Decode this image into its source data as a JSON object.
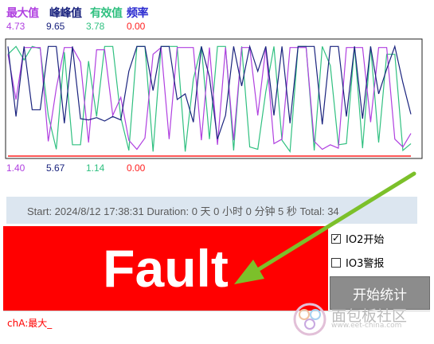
{
  "legend": [
    {
      "label": "最大值",
      "color": "#b040e0"
    },
    {
      "label": "峰峰值",
      "color": "#1a237e"
    },
    {
      "label": "有效值",
      "color": "#30c080"
    },
    {
      "label": "频率",
      "color": "#2a2ad0"
    }
  ],
  "top_values": [
    "4.73",
    "9.65",
    "3.78",
    "0.00"
  ],
  "bottom_values": [
    "1.40",
    "5.67",
    "1.14",
    "0.00"
  ],
  "value_colors": [
    "#b040e0",
    "#1a237e",
    "#30c080",
    "#ff2020"
  ],
  "chart_data": {
    "type": "line",
    "grid": false,
    "x": [
      0,
      1,
      2,
      3,
      4,
      5,
      6,
      7,
      8,
      9,
      10,
      11,
      12,
      13,
      14,
      15,
      16,
      17,
      18,
      19,
      20,
      21,
      22,
      23,
      24,
      25,
      26,
      27,
      28,
      29,
      30,
      31,
      32,
      33,
      34,
      35,
      36,
      37,
      38,
      39,
      40,
      41,
      42,
      43,
      44,
      45,
      46,
      47,
      48,
      49,
      50
    ],
    "ylim": [
      0,
      10
    ],
    "series": [
      {
        "name": "最大值",
        "color": "#b040e0",
        "values": [
          9.0,
          5.0,
          9.6,
          9.6,
          9.6,
          1.3,
          6.0,
          9.6,
          9.6,
          8.3,
          1.2,
          9.4,
          9.4,
          3.6,
          5.2,
          1.4,
          0.6,
          1.6,
          9.0,
          9.6,
          1.5,
          9.6,
          9.6,
          9.6,
          1.4,
          9.6,
          1.0,
          9.6,
          1.4,
          9.6,
          9.6,
          3.6,
          9.6,
          1.1,
          1.5,
          9.6,
          9.6,
          9.6,
          1.3,
          0.6,
          1.0,
          0.7,
          9.6,
          9.6,
          9.6,
          3.0,
          9.6,
          9.6,
          1.5,
          0.8,
          2.0
        ]
      },
      {
        "name": "峰峰值",
        "color": "#1a237e",
        "values": [
          9.7,
          3.5,
          9.7,
          4.1,
          4.1,
          9.7,
          9.7,
          2.9,
          9.7,
          3.3,
          3.2,
          3.4,
          3.1,
          3.5,
          3.2,
          7.5,
          9.7,
          9.7,
          5.8,
          9.7,
          9.7,
          5.0,
          5.5,
          3.0,
          9.7,
          7.0,
          1.5,
          3.6,
          9.7,
          6.2,
          9.7,
          7.5,
          9.7,
          3.6,
          9.7,
          2.9,
          9.7,
          9.7,
          9.7,
          2.8,
          9.7,
          9.7,
          3.5,
          9.7,
          3.3,
          9.7,
          5.5,
          7.7,
          9.7,
          6.5,
          3.7
        ]
      },
      {
        "name": "有效值",
        "color": "#30c080",
        "values": [
          9.0,
          9.7,
          8.5,
          9.7,
          9.5,
          3.6,
          0.6,
          9.2,
          1.0,
          1.0,
          8.4,
          3.5,
          9.7,
          9.7,
          3.4,
          0.5,
          9.7,
          9.7,
          0.4,
          9.7,
          9.7,
          9.7,
          0.4,
          6.8,
          9.7,
          1.5,
          9.7,
          9.7,
          0.5,
          9.7,
          0.8,
          0.6,
          5.7,
          9.7,
          1.4,
          0.4,
          9.7,
          9.7,
          0.5,
          9.7,
          8.0,
          1.0,
          1.1,
          9.7,
          0.7,
          9.7,
          1.2,
          9.0,
          9.0,
          0.5,
          1.1
        ]
      },
      {
        "name": "频率",
        "color": "#ff2020",
        "values": [
          0,
          0,
          0,
          0,
          0,
          0,
          0,
          0,
          0,
          0,
          0,
          0,
          0,
          0,
          0,
          0,
          0,
          0,
          0,
          0,
          0,
          0,
          0,
          0,
          0,
          0,
          0,
          0,
          0,
          0,
          0,
          0,
          0,
          0,
          0,
          0,
          0,
          0,
          0,
          0,
          0,
          0,
          0,
          0,
          0,
          0,
          0,
          0,
          0,
          0,
          0
        ]
      }
    ]
  },
  "status": {
    "text": "Start: 2024/8/12 17:38:31  Duration: 0 天 0 小时 0 分钟 5 秒  Total: 34"
  },
  "fault": {
    "label": "Fault",
    "bg_color": "#ff0000"
  },
  "checkboxes": [
    {
      "label": "IO2开始",
      "checked": true
    },
    {
      "label": "IO3警报",
      "checked": false
    }
  ],
  "start_button": {
    "label": "开始统计"
  },
  "log": {
    "text": "chA:最大_"
  },
  "arrow": {
    "color": "#7cc02a"
  },
  "watermark": {
    "text": "面包板社区",
    "sub": "www.eet-china.com"
  }
}
